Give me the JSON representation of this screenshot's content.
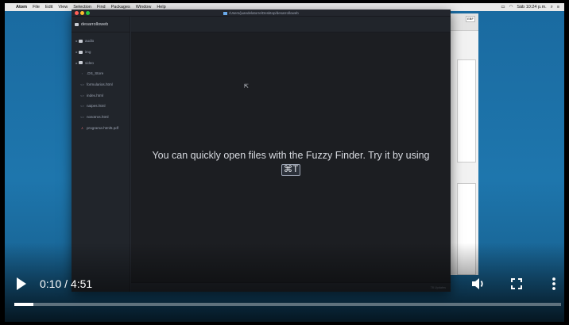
{
  "menubar": {
    "apple": "",
    "app_name": "Atom",
    "menus": [
      "File",
      "Edit",
      "View",
      "Selection",
      "Find",
      "Packages",
      "Window",
      "Help"
    ],
    "clock": "Sáb 10:24 p.m."
  },
  "background_window": {
    "chip_text": "EBF"
  },
  "atom": {
    "title": "/Users/juandelatorre/Desktop/desarrolloweb",
    "project": "desarrolloweb",
    "folders": [
      "audio",
      "img",
      "video"
    ],
    "files": [
      ".DS_Store",
      "formularios.html",
      "index.html",
      "naipes.html",
      "nosotros.html"
    ],
    "pdf_file": "programa-html5.pdf",
    "hint_text": "You can quickly open files with the Fuzzy Finder. Try it by using",
    "hint_key": "⌘T",
    "status_right": "78 Updates"
  },
  "player": {
    "time": "0:10 / 4:51",
    "progress": 0.035
  },
  "colors": {
    "desktop": "#1d6fa3",
    "atom_bg": "#282c34",
    "tree_bg": "#21252b",
    "progress_fill": "#ffffff"
  },
  "icons": {
    "play": "play-icon",
    "volume": "volume-icon",
    "fullscreen": "fullscreen-icon",
    "more": "more-vert-icon"
  }
}
